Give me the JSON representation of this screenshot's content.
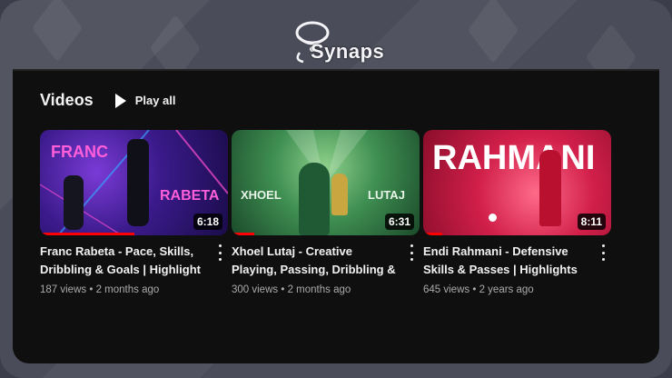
{
  "brand": {
    "name": "Synaps"
  },
  "section": {
    "title": "Videos",
    "play_all_label": "Play all"
  },
  "videos": [
    {
      "title": "Franc Rabeta - Pace, Skills, Dribbling & Goals | Highlight",
      "views": "187 views",
      "age": "2 months ago",
      "duration": "6:18",
      "watched_fraction": 0.5,
      "thumb_text_1": "FRANC",
      "thumb_text_2": "RABETA"
    },
    {
      "title": "Xhoel Lutaj - Creative Playing, Passing, Dribbling & Goals | ...",
      "views": "300 views",
      "age": "2 months ago",
      "duration": "6:31",
      "watched_fraction": 0.12,
      "thumb_text_1": "XHOEL",
      "thumb_text_2": "LUTAJ"
    },
    {
      "title": "Endi Rahmani - Defensive Skills & Passes | Highlights",
      "views": "645 views",
      "age": "2 years ago",
      "duration": "8:11",
      "watched_fraction": 0.1,
      "thumb_text_1": "RAHMANI"
    }
  ],
  "separator": "•",
  "colors": {
    "progress": "#ff0000",
    "panel_bg": "#0f0f0f",
    "meta_text": "#aaaaaa"
  }
}
